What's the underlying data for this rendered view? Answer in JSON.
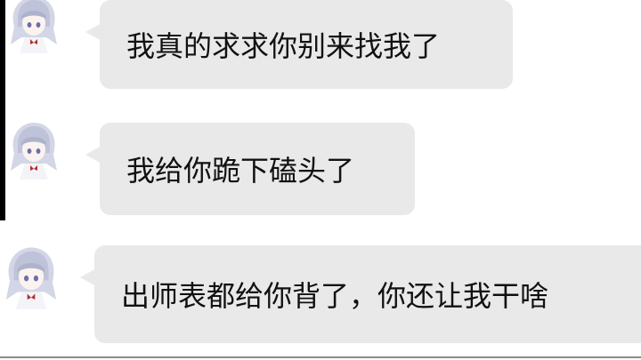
{
  "chat": {
    "messages": [
      {
        "text": "我真的求求你别来找我了",
        "avatar_icon": "anime-girl-avatar-icon"
      },
      {
        "text": "我给你跪下磕头了",
        "avatar_icon": "anime-girl-avatar-icon"
      },
      {
        "text": "出师表都给你背了，你还让我干啥",
        "avatar_icon": "anime-girl-avatar-icon"
      }
    ]
  },
  "colors": {
    "bubble": "#e9e9e9",
    "text": "#111111",
    "background": "#ffffff",
    "avatar_hair": "#c9cde0",
    "avatar_bow": "#b03030"
  }
}
